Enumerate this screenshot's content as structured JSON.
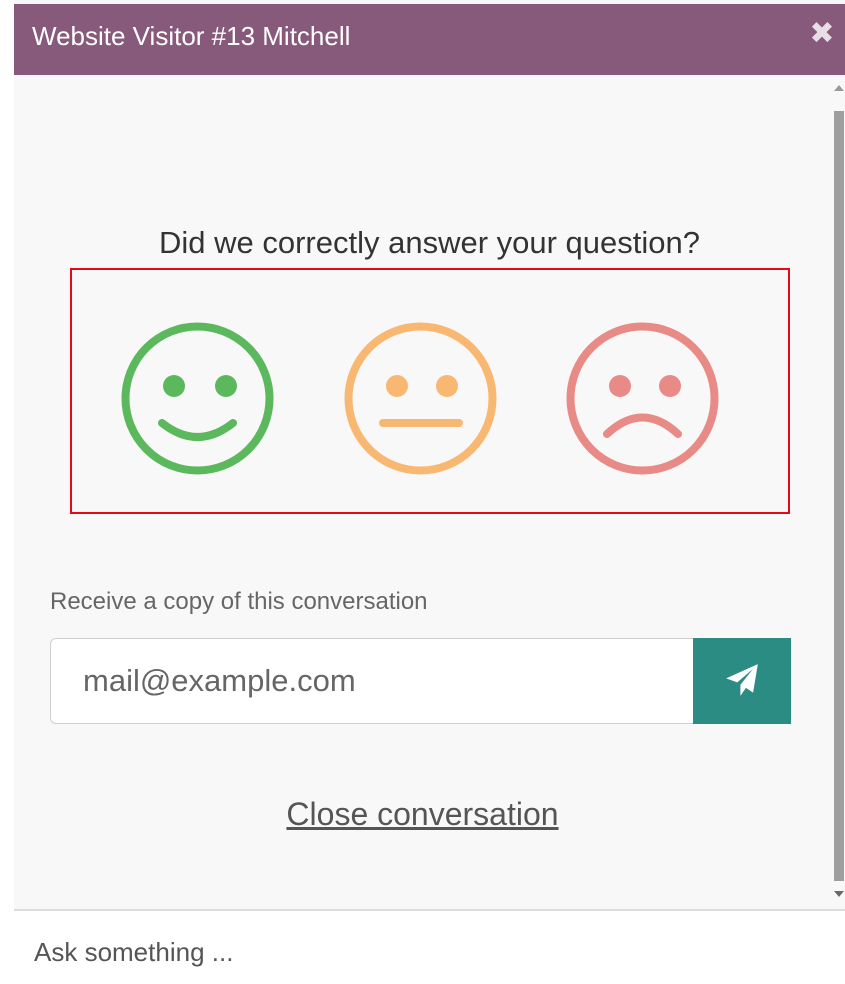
{
  "header": {
    "title": "Website Visitor #13 Mitchell",
    "close_icon": "close-icon"
  },
  "rating": {
    "question": "Did we correctly answer your question?",
    "options": [
      {
        "name": "happy",
        "color": "#5cb85c",
        "icon": "smiley-happy-icon"
      },
      {
        "name": "neutral",
        "color": "#f9b872",
        "icon": "smiley-neutral-icon"
      },
      {
        "name": "sad",
        "color": "#e88a85",
        "icon": "smiley-sad-icon"
      }
    ],
    "highlight_color": "#e30b17"
  },
  "transcript": {
    "label": "Receive a copy of this conversation",
    "email_placeholder": "mail@example.com",
    "send_icon": "paper-plane-icon",
    "send_color": "#2b8c83"
  },
  "actions": {
    "close_conversation": "Close conversation"
  },
  "composer": {
    "placeholder": "Ask something ..."
  },
  "theme": {
    "header_color": "#875a7b"
  }
}
